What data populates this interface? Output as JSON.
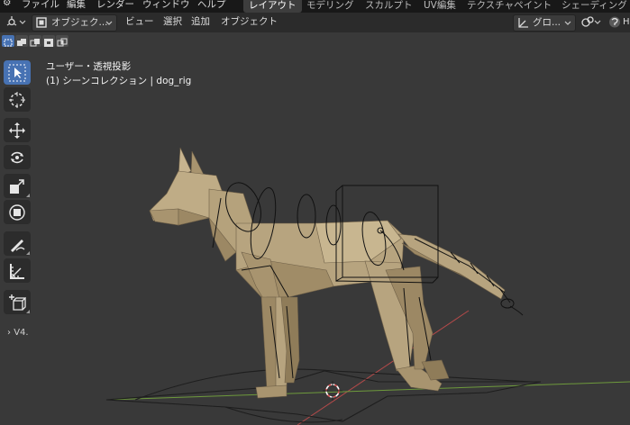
{
  "topbar": {
    "menus": [
      "ファイル",
      "編集",
      "レンダー",
      "ウィンドウ",
      "ヘルプ"
    ],
    "workspaces": [
      "レイアウト",
      "モデリング",
      "スカルプト",
      "UV編集",
      "テクスチャペイント",
      "シェーディング"
    ],
    "active_workspace": "レイアウト"
  },
  "header": {
    "mode_label": "オブジェク...",
    "menus": [
      "ビュー",
      "選択",
      "追加",
      "オブジェクト"
    ],
    "transform_orientation": "グロ...",
    "right_label": "H"
  },
  "viewport": {
    "view_name": "ユーザー・透視投影",
    "collection_label": "(1) シーンコレクション | dog_rig",
    "collapsed_panel_label": "V4."
  },
  "colors": {
    "accent": "#4772b3",
    "viewport_bg": "#393939",
    "header_bg": "#2b2b2b",
    "topbar_bg": "#181818",
    "model_color": "#b7a47f",
    "x_axis": "#b34a4a",
    "y_axis": "#6e9a3c"
  },
  "tools": [
    "select-box-icon",
    "cursor-icon",
    "move-icon",
    "rotate-icon",
    "scale-icon",
    "transform-icon",
    "annotate-icon",
    "measure-icon",
    "add-cube-icon"
  ]
}
